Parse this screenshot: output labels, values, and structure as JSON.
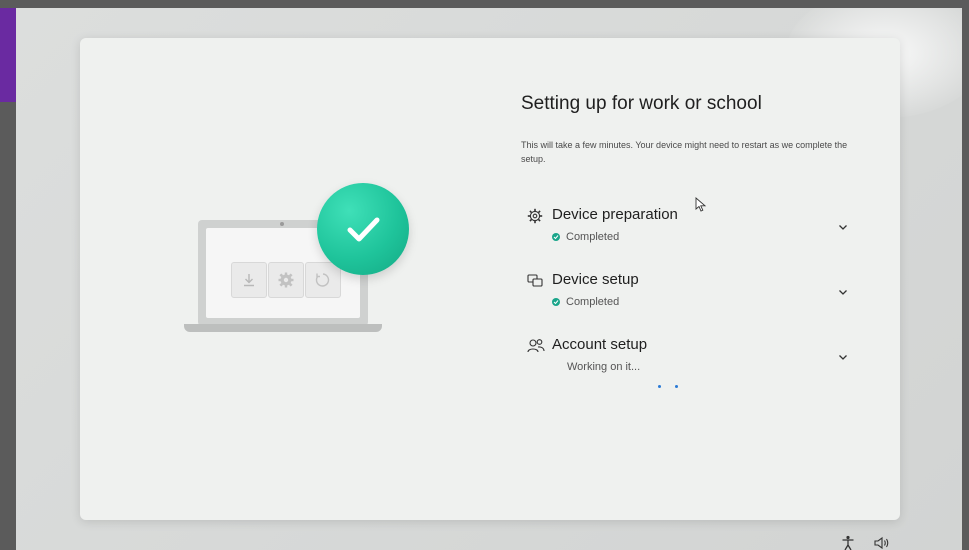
{
  "setup": {
    "title": "Setting up for work or school",
    "description": "This will take a few minutes. Your device might need to restart as we complete the setup.",
    "steps": [
      {
        "name": "Device preparation",
        "status": "Completed",
        "state": "completed",
        "icon": "gear-icon"
      },
      {
        "name": "Device setup",
        "status": "Completed",
        "state": "completed",
        "icon": "device-setup-icon"
      },
      {
        "name": "Account setup",
        "status": "Working on it...",
        "state": "in-progress",
        "icon": "account-icon"
      }
    ]
  },
  "illustration": {
    "tiles": [
      "download-icon",
      "settings-icon",
      "restart-icon"
    ],
    "badge": "checkmark-icon"
  },
  "tray": {
    "icons": [
      "accessibility-icon",
      "volume-icon"
    ]
  },
  "colors": {
    "accent_green": "#1fc49b",
    "status_dot": "#1aa58a",
    "progress_blue": "#2b7bd6",
    "purple_tab": "#6a2aa1"
  }
}
